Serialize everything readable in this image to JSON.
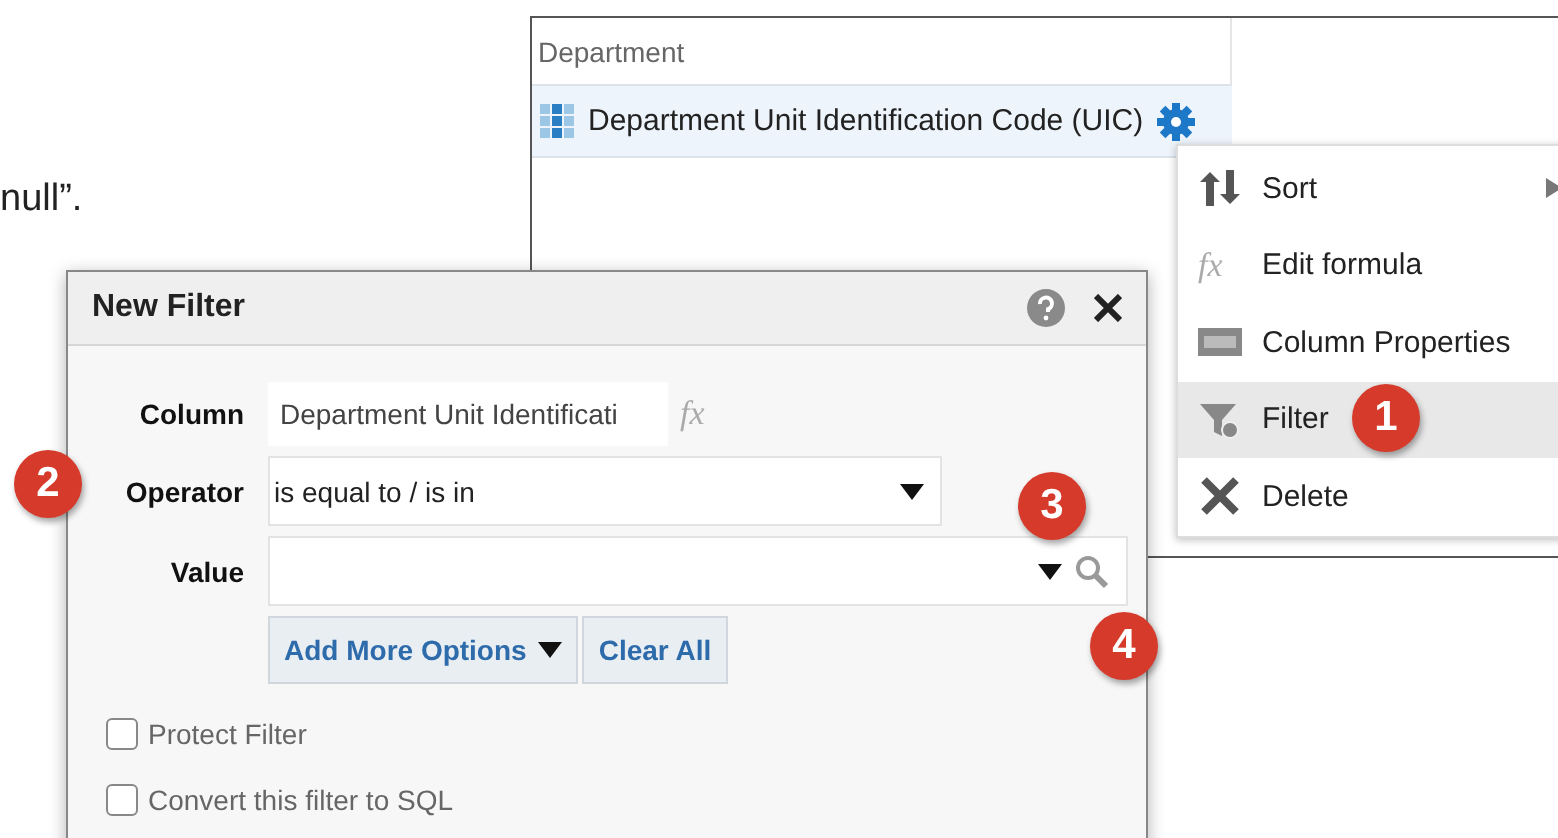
{
  "fragment_text": "null”.",
  "column_panel": {
    "header": "Department",
    "column": {
      "label": "Department Unit Identification Code (UIC)"
    }
  },
  "context_menu": {
    "items": [
      {
        "kind": "sort",
        "label": "Sort",
        "selected": false,
        "has_submenu": true
      },
      {
        "kind": "formula",
        "label": "Edit formula",
        "icon_text": "fx",
        "selected": false,
        "has_submenu": false
      },
      {
        "kind": "properties",
        "label": "Column Properties",
        "selected": false,
        "has_submenu": false
      },
      {
        "kind": "filter",
        "label": "Filter",
        "selected": true,
        "has_submenu": false
      },
      {
        "kind": "delete",
        "label": "Delete",
        "selected": false,
        "has_submenu": false
      }
    ]
  },
  "dialog": {
    "title": "New Filter",
    "column": {
      "label": "Column",
      "value": "Department Unit Identificati",
      "formula_symbol": "fx"
    },
    "operator": {
      "label": "Operator",
      "value": "is equal to / is in"
    },
    "value": {
      "label": "Value"
    },
    "buttons": [
      "Add More Options",
      "Clear All"
    ],
    "checkboxes": [
      {
        "label": "Protect Filter",
        "checked": false
      },
      {
        "label": "Convert this filter to SQL",
        "checked": false
      }
    ]
  },
  "callouts": [
    "1",
    "2",
    "3",
    "4"
  ]
}
